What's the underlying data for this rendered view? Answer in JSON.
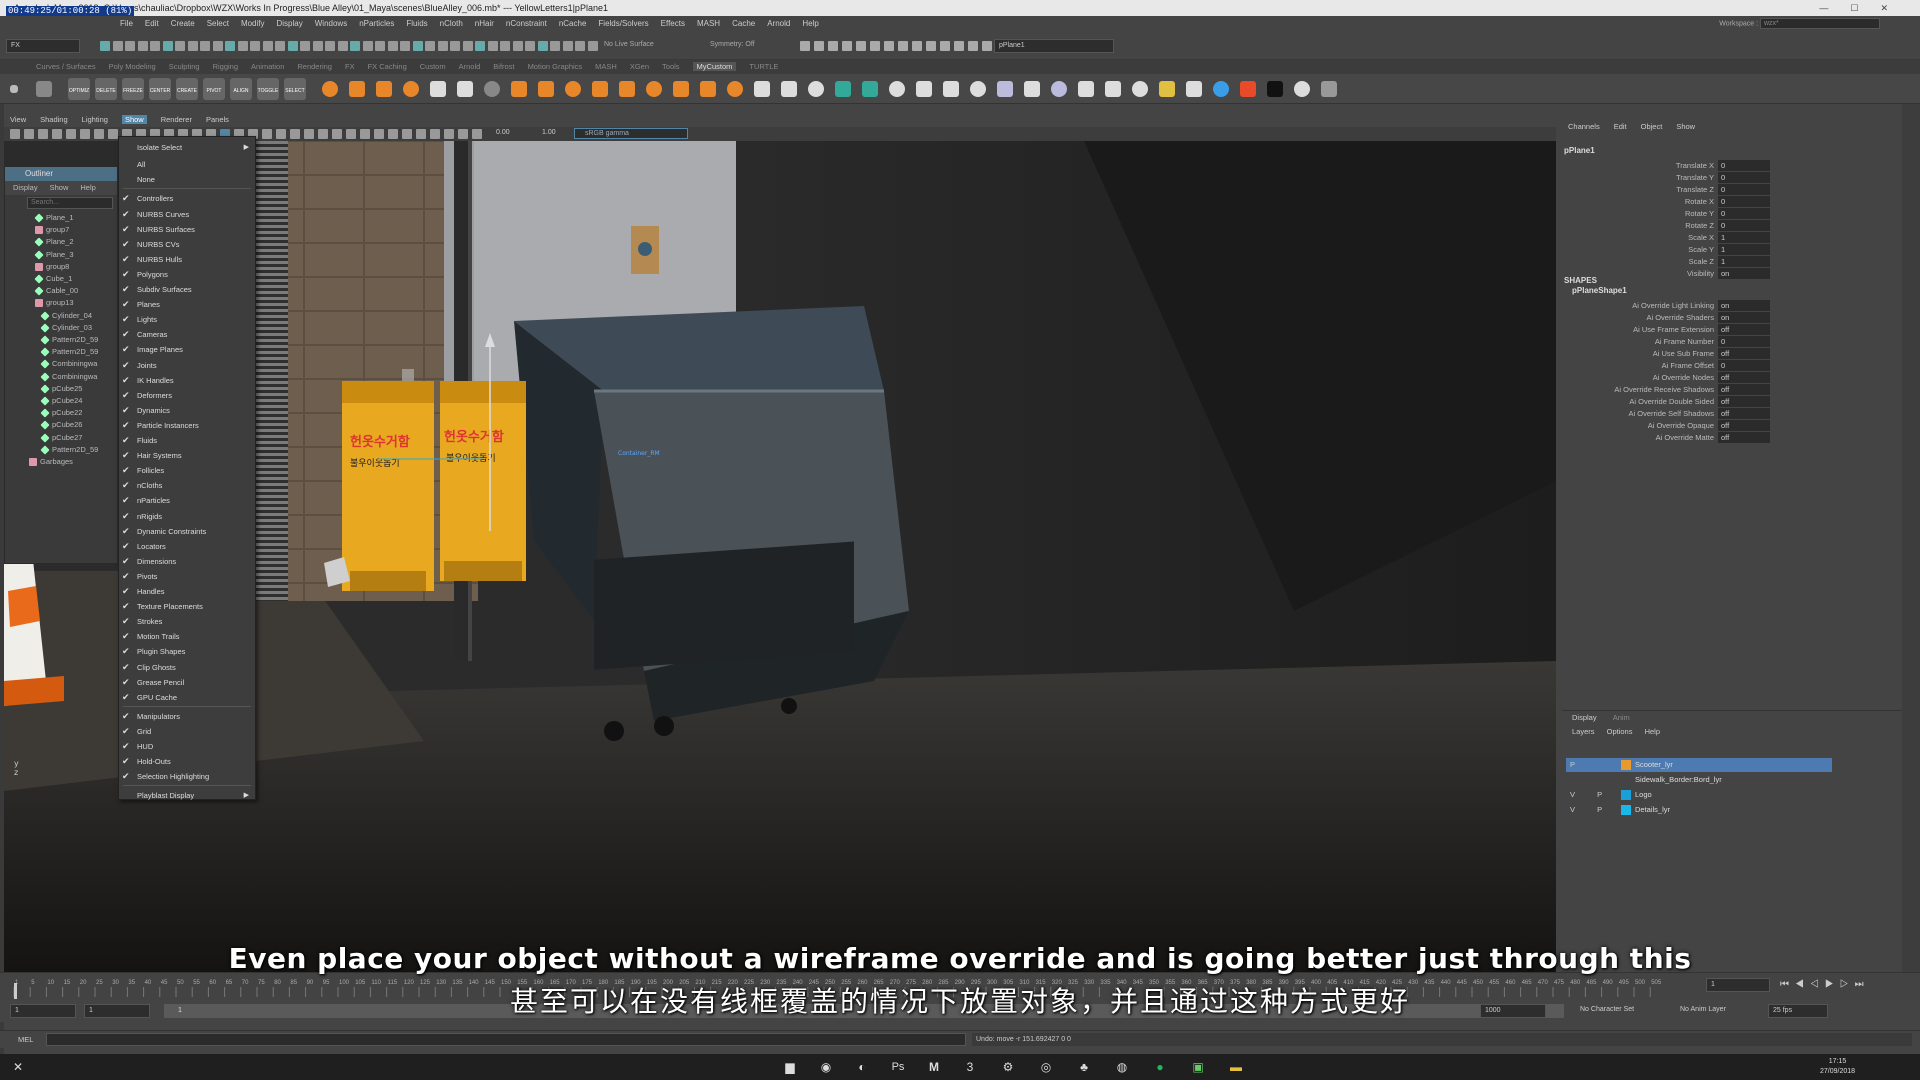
{
  "window": {
    "title": "Autodesk Maya 2018: C:\\Users\\chauliac\\Dropbox\\WZX\\Works In Progress\\Blue Alley\\01_Maya\\scenes\\BlueAlley_006.mb*  ---  YellowLetters1|pPlane1",
    "timer_line1": "00:49:25/01:00:28 (81%)"
  },
  "menubar": {
    "items": [
      "File",
      "Edit",
      "Create",
      "Select",
      "Modify",
      "Display",
      "Windows",
      "nParticles",
      "Fluids",
      "nCloth",
      "nHair",
      "nConstraint",
      "nCache",
      "Fields/Solvers",
      "Effects",
      "MASH",
      "Cache",
      "Arnold",
      "Help"
    ],
    "workspace_label": "Workspace :",
    "workspace_value": "wzx*"
  },
  "statusline": {
    "mode": "FX",
    "live_surface": "No Live Surface",
    "symmetry": "Symmetry: Off",
    "object_name": "pPlane1"
  },
  "shelf_tabs": [
    "Curves / Surfaces",
    "Poly Modeling",
    "Sculpting",
    "Rigging",
    "Animation",
    "Rendering",
    "FX",
    "FX Caching",
    "Custom",
    "Arnold",
    "Bifrost",
    "Motion Graphics",
    "MASH",
    "XGen",
    "Tools",
    "MyCustom",
    "TURTLE"
  ],
  "shelf_active": "MyCustom",
  "shelf_labels": [
    "OPTIMIZ",
    "DELETE",
    "FREEZE",
    "CENTER",
    "CREATE",
    "PIVOT",
    "ALIGN",
    "TOGGLE",
    "SELECT"
  ],
  "panel_menu": [
    "View",
    "Shading",
    "Lighting",
    "Show",
    "Renderer",
    "Panels"
  ],
  "panel_menu_active": "Show",
  "panel_toolbar": {
    "exposure": "0.00",
    "gamma": "1.00",
    "colorspace": "sRGB gamma"
  },
  "outliner": {
    "title": "Outliner",
    "menu": [
      "Display",
      "Show",
      "Help"
    ],
    "search_placeholder": "Search...",
    "rows": [
      "Plane_1",
      "group7",
      "Plane_2",
      "Plane_3",
      "group8",
      "Cube_1",
      "Cable_00",
      "group13",
      "Cylinder_04",
      "Cylinder_03",
      "Pattern2D_59",
      "Pattern2D_59",
      "Combiningwa",
      "Combiningwa",
      "pCube25",
      "pCube24",
      "pCube22",
      "pCube26",
      "pCube27",
      "Pattern2D_59",
      "Garbages"
    ]
  },
  "show_menu": {
    "top": [
      {
        "label": "Isolate Select",
        "arrow": true
      },
      {
        "label": "All"
      },
      {
        "label": "None"
      }
    ],
    "items": [
      "Controllers",
      "NURBS Curves",
      "NURBS Surfaces",
      "NURBS CVs",
      "NURBS Hulls",
      "Polygons",
      "Subdiv Surfaces",
      "Planes",
      "Lights",
      "Cameras",
      "Image Planes",
      "Joints",
      "IK Handles",
      "Deformers",
      "Dynamics",
      "Particle Instancers",
      "Fluids",
      "Hair Systems",
      "Follicles",
      "nCloths",
      "nParticles",
      "nRigids",
      "Dynamic Constraints",
      "Locators",
      "Dimensions",
      "Pivots",
      "Handles",
      "Texture Placements",
      "Strokes",
      "Motion Trails",
      "Plugin Shapes",
      "Clip Ghosts",
      "Grease Pencil",
      "GPU Cache"
    ],
    "items2": [
      "Manipulators",
      "Grid",
      "HUD",
      "Hold-Outs",
      "Selection Highlighting"
    ],
    "bottom": {
      "label": "Playblast Display",
      "arrow": true
    }
  },
  "channel_box": {
    "menu": [
      "Channels",
      "Edit",
      "Object",
      "Show"
    ],
    "object": "pPlane1",
    "attrs": [
      {
        "label": "Translate X",
        "value": "0"
      },
      {
        "label": "Translate Y",
        "value": "0"
      },
      {
        "label": "Translate Z",
        "value": "0"
      },
      {
        "label": "Rotate X",
        "value": "0"
      },
      {
        "label": "Rotate Y",
        "value": "0"
      },
      {
        "label": "Rotate Z",
        "value": "0"
      },
      {
        "label": "Scale X",
        "value": "1"
      },
      {
        "label": "Scale Y",
        "value": "1"
      },
      {
        "label": "Scale Z",
        "value": "1"
      },
      {
        "label": "Visibility",
        "value": "on"
      }
    ],
    "shapes_header": "SHAPES",
    "shape_name": "pPlaneShape1",
    "shape_attrs": [
      {
        "label": "Ai Override Light Linking",
        "value": "on"
      },
      {
        "label": "Ai Override Shaders",
        "value": "on"
      },
      {
        "label": "Ai Use Frame Extension",
        "value": "off"
      },
      {
        "label": "Ai Frame Number",
        "value": "0"
      },
      {
        "label": "Ai Use Sub Frame",
        "value": "off"
      },
      {
        "label": "Ai Frame Offset",
        "value": "0"
      },
      {
        "label": "Ai Override Nodes",
        "value": "off"
      },
      {
        "label": "Ai Override Receive Shadows",
        "value": "off"
      },
      {
        "label": "Ai Override Double Sided",
        "value": "off"
      },
      {
        "label": "Ai Override Self Shadows",
        "value": "off"
      },
      {
        "label": "Ai Override Opaque",
        "value": "off"
      },
      {
        "label": "Ai Override Matte",
        "value": "off"
      }
    ]
  },
  "layers": {
    "tabs": [
      "Display",
      "Anim"
    ],
    "menu": [
      "Layers",
      "Options",
      "Help"
    ],
    "rows": [
      {
        "flags": "  P",
        "name": "Scooter_lyr",
        "color": "#e89a2c",
        "selected": true
      },
      {
        "flags": "",
        "name": "Sidewalk_Border:Bord_lyr",
        "color": "#444444",
        "selected": false
      },
      {
        "flags": "V P R",
        "name": "Logo",
        "color": "#1aa0d8",
        "selected": false
      },
      {
        "flags": "V P",
        "name": "Details_lyr",
        "color": "#1ab8e8",
        "selected": false
      }
    ]
  },
  "viewport": {
    "label": "Container_RM",
    "axis_y": "y",
    "axis_z": "z"
  },
  "timeline": {
    "ticks": [
      "1",
      "5",
      "10",
      "15",
      "20",
      "25",
      "30",
      "35",
      "40",
      "45",
      "50",
      "55",
      "60",
      "65",
      "70",
      "75",
      "80",
      "85",
      "90",
      "95",
      "100",
      "105",
      "110",
      "115",
      "120",
      "125",
      "130",
      "135",
      "140",
      "145",
      "150",
      "155",
      "160",
      "165",
      "170",
      "175",
      "180",
      "185",
      "190",
      "195",
      "200",
      "205",
      "210",
      "215",
      "220",
      "225",
      "230",
      "235",
      "240",
      "245",
      "250",
      "255",
      "260",
      "265",
      "270",
      "275",
      "280",
      "285",
      "290",
      "295",
      "300",
      "305",
      "310",
      "315",
      "320",
      "325",
      "330",
      "335",
      "340",
      "345",
      "350",
      "355",
      "360",
      "365",
      "370",
      "375",
      "380",
      "385",
      "390",
      "395",
      "400",
      "405",
      "410",
      "415",
      "420",
      "425",
      "430",
      "435",
      "440",
      "445",
      "450",
      "455",
      "460",
      "465",
      "470",
      "475",
      "480",
      "485",
      "490",
      "495",
      "500",
      "505"
    ],
    "current_frame": "1",
    "range_start": "1",
    "range_inner_start": "1",
    "range_inner_value": "1",
    "range_end": "1000",
    "character_set": "No Character Set",
    "anim_layer": "No Anim Layer",
    "fps": "25 fps"
  },
  "cmdline": {
    "label": "MEL",
    "feedback": "Undo: move -r 151.692427 0 0"
  },
  "taskbar": {
    "time": "17:15",
    "date": "27/09/2018"
  },
  "subtitles": {
    "english": "Even place your object without a wireframe override and is going better just through this",
    "chinese": "甚至可以在没有线框覆盖的情况下放置对象，并且通过这种方式更好"
  },
  "colors": {
    "accent": "#5285a6",
    "selected_layer": "#4d7ab0",
    "bin_yellow": "#e8a820"
  }
}
